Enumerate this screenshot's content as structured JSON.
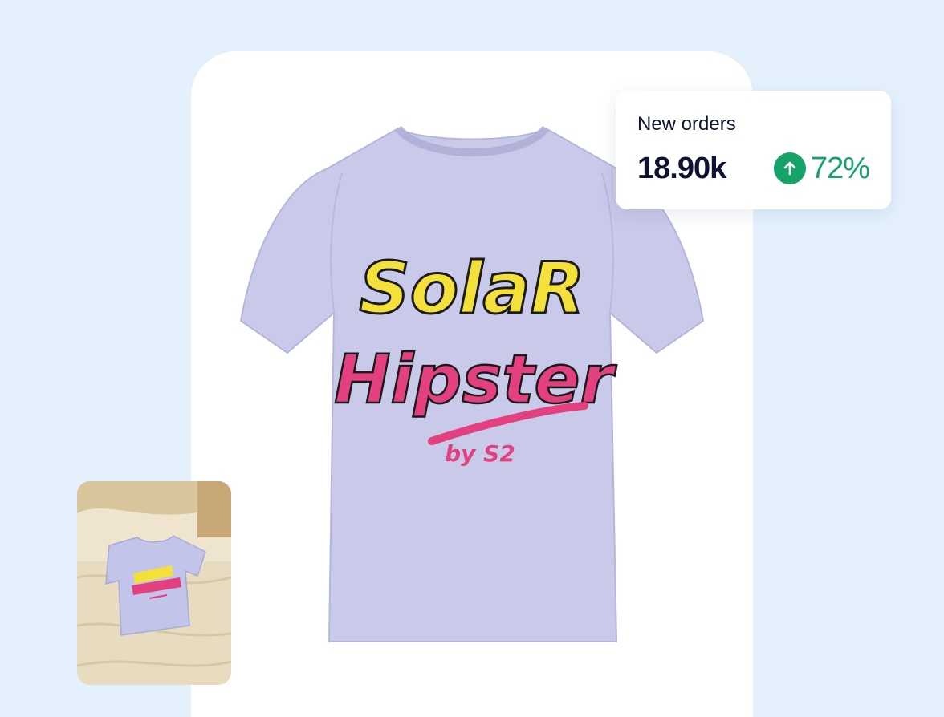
{
  "stat_card": {
    "title": "New orders",
    "value": "18.90k",
    "change": "72%",
    "trend_icon": "arrow-up-icon",
    "trend_color": "#16a36a"
  },
  "product": {
    "print_line1": "SolaR",
    "print_line2": "Hipster",
    "print_line3": "by S2",
    "shirt_color": "#c9c9ea",
    "print_colors": [
      "#f4e03a",
      "#e2407f"
    ]
  },
  "colors": {
    "background": "#e4f1fd",
    "card": "#ffffff",
    "text": "#0d1330"
  }
}
